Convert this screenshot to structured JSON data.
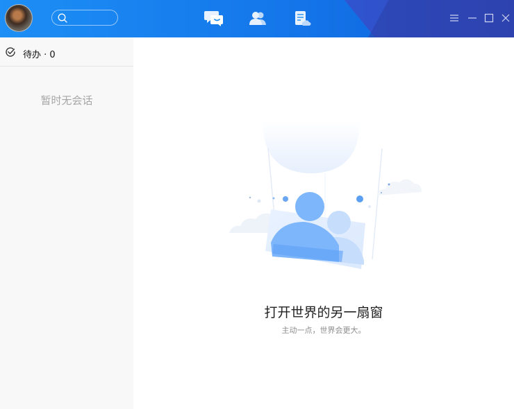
{
  "topbar": {
    "avatar": "avatar",
    "search_icon": "search-icon",
    "nav": [
      {
        "name": "messages",
        "icon": "chat-bubble-icon"
      },
      {
        "name": "contacts",
        "icon": "contacts-icon"
      },
      {
        "name": "docs",
        "icon": "document-icon"
      }
    ],
    "window_controls": [
      "menu-icon",
      "minimize-icon",
      "maximize-icon",
      "close-icon"
    ],
    "accent": "#1d8ff5"
  },
  "sidebar": {
    "todo_label": "待办 · 0",
    "empty_text": "暂时无会话"
  },
  "main": {
    "headline": "打开世界的另一扇窗",
    "subline": "主动一点，世界会更大。"
  }
}
